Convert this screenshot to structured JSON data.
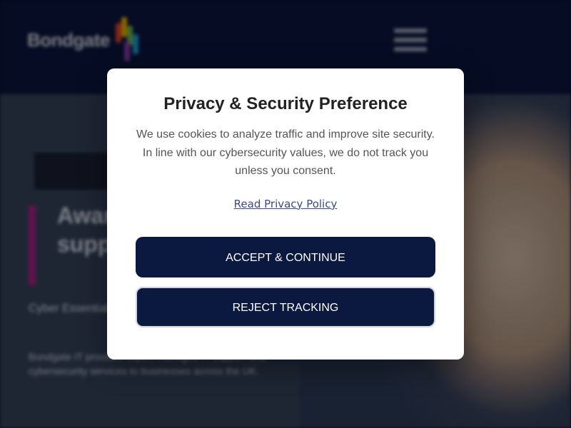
{
  "site": {
    "logo_text": "Bondgate",
    "logo_colors": [
      "#e8452c",
      "#f7b500",
      "#6bbf4e",
      "#1fa3d9",
      "#8e3fb5"
    ],
    "hero": {
      "title": "Award-winning support for UK",
      "subtitle": "Cyber Essentials ...",
      "body": "Bondgate IT provides expert managed IT support and cybersecurity services to businesses across the UK."
    }
  },
  "modal": {
    "title": "Privacy & Security Preference",
    "text": "We use cookies to analyze traffic and improve site security. In line with our cybersecurity values, we do not track you unless you consent.",
    "policy_link": "Read Privacy Policy",
    "accept_label": "ACCEPT & CONTINUE",
    "reject_label": "REJECT TRACKING"
  },
  "colors": {
    "header_bg": "#0b1640",
    "button_bg": "#0b1840",
    "accent": "#b0238c"
  },
  "icons": {
    "menu": "hamburger-menu-icon"
  }
}
